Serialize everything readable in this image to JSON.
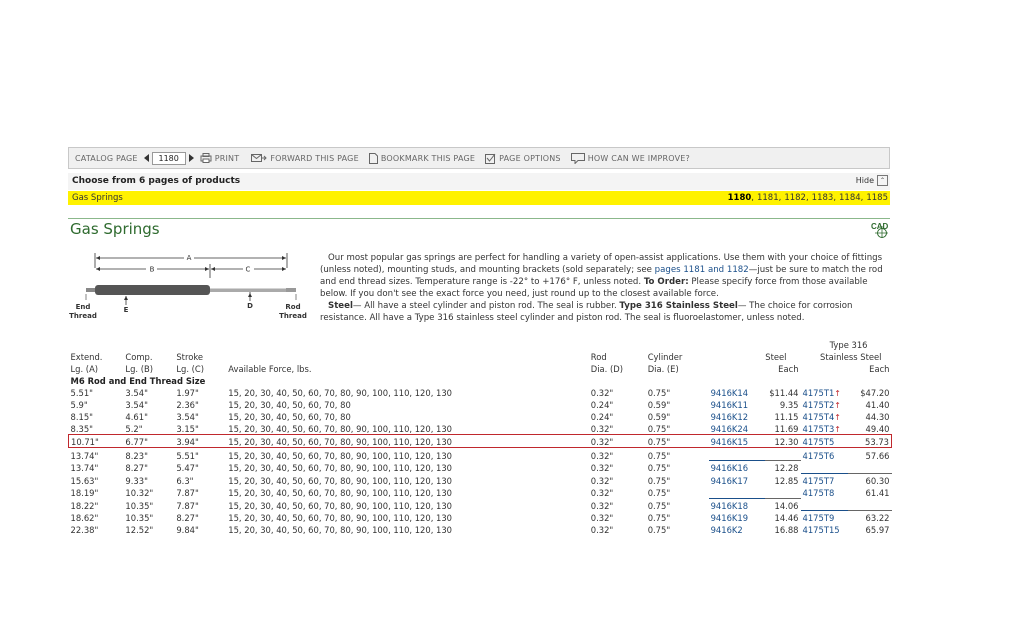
{
  "toolbar": {
    "catalog_page_label": "CATALOG PAGE",
    "page_value": "1180",
    "print": "PRINT",
    "forward": "FORWARD THIS PAGE",
    "bookmark": "BOOKMARK THIS PAGE",
    "options": "PAGE OPTIONS",
    "improve": "HOW CAN WE IMPROVE?"
  },
  "choose": {
    "text": "Choose from 6 pages of products",
    "hide": "Hide"
  },
  "pages_bar": {
    "category": "Gas Springs",
    "pages": [
      "1180",
      "1181",
      "1182",
      "1183",
      "1184",
      "1185"
    ],
    "current": "1180"
  },
  "title": "Gas Springs",
  "cad_label": "CAD",
  "diagram": {
    "A": "A",
    "B": "B",
    "C": "C",
    "D": "D",
    "E": "E",
    "end_thread": [
      "End",
      "Thread"
    ],
    "rod_thread": [
      "Rod",
      "Thread"
    ]
  },
  "description": {
    "p1_a": "Our most popular gas springs are perfect for handling a variety of open-assist applications. Use them with your choice of fittings (unless noted), mounting studs, and mounting brackets (sold separately; see ",
    "p1_link": "pages 1181 and 1182",
    "p1_b": "—just be sure to match the rod and end thread sizes. Temperature range is -22° to +176° F, unless noted. ",
    "to_order": "To Order:",
    "p1_c": " Please specify force from those available below. If you don't see the exact force you need, just round up to the closest available force.",
    "steel_label": "Steel",
    "p2_a": "— All have a steel cylinder and piston rod. The seal is rubber. ",
    "ss_label": "Type 316 Stainless Steel",
    "p2_b": "— The choice for corrosion resistance. All have a Type 316 stainless steel cylinder and piston rod. The seal is fluoroelastomer, unless noted."
  },
  "table": {
    "headers": {
      "ext1": "Extend.",
      "ext2": "Lg. (A)",
      "comp1": "Comp.",
      "comp2": "Lg. (B)",
      "stroke1": "Stroke",
      "stroke2": "Lg. (C)",
      "force": "Available Force, lbs.",
      "rod1": "Rod",
      "rod2": "Dia. (D)",
      "cyl1": "Cylinder",
      "cyl2": "Dia. (E)",
      "steel": "Steel",
      "each": "Each",
      "ss1": "Type 316",
      "ss2": "Stainless Steel",
      "each2": "Each"
    },
    "section": "M6 Rod and End Thread Size",
    "rows": [
      {
        "a": "5.51\"",
        "b": "3.54\"",
        "c": "1.97\"",
        "force": "15, 20, 30, 40, 50, 60, 70, 80, 90, 100, 110, 120, 130",
        "d": "0.32\"",
        "e": "0.75\"",
        "steel_pn": "9416K14",
        "steel_price": "$11.44",
        "ss_pn": "4175T1",
        "ss_arrow": "↑",
        "ss_price": "$47.20"
      },
      {
        "a": "5.9\"",
        "b": "3.54\"",
        "c": "2.36\"",
        "force": "15, 20, 30, 40, 50, 60, 70, 80",
        "d": "0.24\"",
        "e": "0.59\"",
        "steel_pn": "9416K11",
        "steel_price": "9.35",
        "ss_pn": "4175T2",
        "ss_arrow": "↑",
        "ss_price": "41.40"
      },
      {
        "a": "8.15\"",
        "b": "4.61\"",
        "c": "3.54\"",
        "force": "15, 20, 30, 40, 50, 60, 70, 80",
        "d": "0.24\"",
        "e": "0.59\"",
        "steel_pn": "9416K12",
        "steel_price": "11.15",
        "ss_pn": "4175T4",
        "ss_arrow": "↑",
        "ss_price": "44.30"
      },
      {
        "a": "8.35\"",
        "b": "5.2\"",
        "c": "3.15\"",
        "force": "15, 20, 30, 40, 50, 60, 70, 80, 90, 100, 110, 120, 130",
        "d": "0.32\"",
        "e": "0.75\"",
        "steel_pn": "9416K24",
        "steel_price": "11.69",
        "ss_pn": "4175T3",
        "ss_arrow": "↑",
        "ss_price": "49.40"
      },
      {
        "a": "10.71\"",
        "b": "6.77\"",
        "c": "3.94\"",
        "force": "15, 20, 30, 40, 50, 60, 70, 80, 90, 100, 110, 120, 130",
        "d": "0.32\"",
        "e": "0.75\"",
        "steel_pn": "9416K15",
        "steel_price": "12.30",
        "ss_pn": "4175T5",
        "ss_arrow": "",
        "ss_price": "53.73"
      },
      {
        "a": "13.74\"",
        "b": "8.23\"",
        "c": "5.51\"",
        "force": "15, 20, 30, 40, 50, 60, 70, 80, 90, 100, 110, 120, 130",
        "d": "0.32\"",
        "e": "0.75\"",
        "steel_pn": "",
        "steel_price": "",
        "ss_pn": "4175T6",
        "ss_arrow": "",
        "ss_price": "57.66"
      },
      {
        "a": "13.74\"",
        "b": "8.27\"",
        "c": "5.47\"",
        "force": "15, 20, 30, 40, 50, 60, 70, 80, 90, 100, 110, 120, 130",
        "d": "0.32\"",
        "e": "0.75\"",
        "steel_pn": "9416K16",
        "steel_price": "12.28",
        "ss_pn": "",
        "ss_arrow": "",
        "ss_price": ""
      },
      {
        "a": "15.63\"",
        "b": "9.33\"",
        "c": "6.3\"",
        "force": "15, 20, 30, 40, 50, 60, 70, 80, 90, 100, 110, 120, 130",
        "d": "0.32\"",
        "e": "0.75\"",
        "steel_pn": "9416K17",
        "steel_price": "12.85",
        "ss_pn": "4175T7",
        "ss_arrow": "",
        "ss_price": "60.30"
      },
      {
        "a": "18.19\"",
        "b": "10.32\"",
        "c": "7.87\"",
        "force": "15, 20, 30, 40, 50, 60, 70, 80, 90, 100, 110, 120, 130",
        "d": "0.32\"",
        "e": "0.75\"",
        "steel_pn": "",
        "steel_price": "",
        "ss_pn": "4175T8",
        "ss_arrow": "",
        "ss_price": "61.41"
      },
      {
        "a": "18.22\"",
        "b": "10.35\"",
        "c": "7.87\"",
        "force": "15, 20, 30, 40, 50, 60, 70, 80, 90, 100, 110, 120, 130",
        "d": "0.32\"",
        "e": "0.75\"",
        "steel_pn": "9416K18",
        "steel_price": "14.06",
        "ss_pn": "",
        "ss_arrow": "",
        "ss_price": ""
      },
      {
        "a": "18.62\"",
        "b": "10.35\"",
        "c": "8.27\"",
        "force": "15, 20, 30, 40, 50, 60, 70, 80, 90, 100, 110, 120, 130",
        "d": "0.32\"",
        "e": "0.75\"",
        "steel_pn": "9416K19",
        "steel_price": "14.46",
        "ss_pn": "4175T9",
        "ss_arrow": "",
        "ss_price": "63.22"
      },
      {
        "a": "22.38\"",
        "b": "12.52\"",
        "c": "9.84\"",
        "force": "15, 20, 30, 40, 50, 60, 70, 80, 90, 100, 110, 120, 130",
        "d": "0.32\"",
        "e": "0.75\"",
        "steel_pn": "9416K2",
        "steel_price": "16.88",
        "ss_pn": "4175T15",
        "ss_arrow": "",
        "ss_price": "65.97"
      }
    ],
    "selected_row": 4
  }
}
